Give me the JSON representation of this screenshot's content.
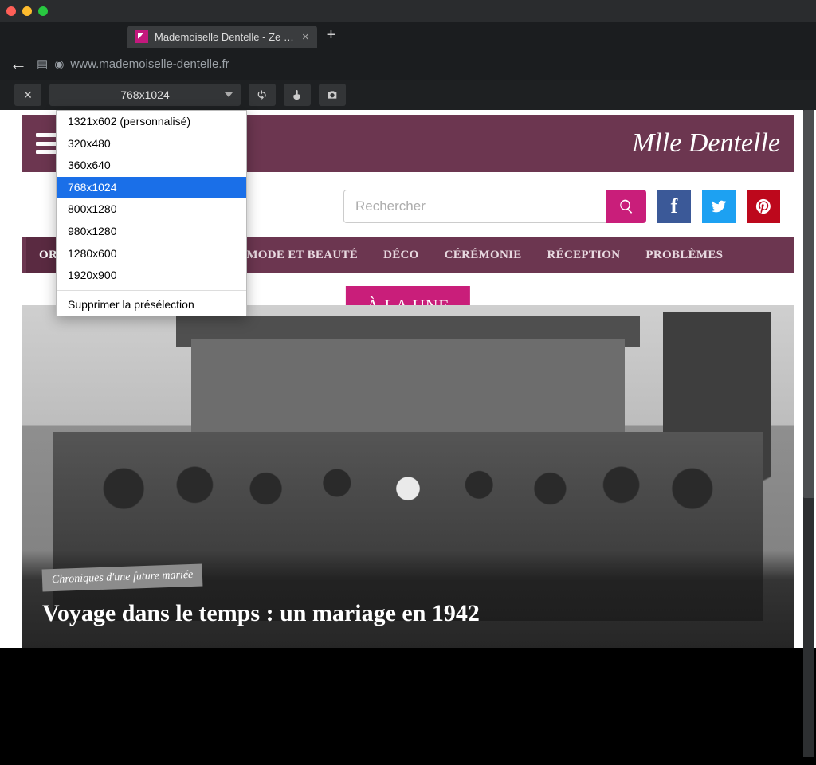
{
  "browser": {
    "tab_title": "Mademoiselle Dentelle - Ze …",
    "url": "www.mademoiselle-dentelle.fr"
  },
  "devtools": {
    "selected_preset": "768x1024",
    "presets": [
      "1321x602 (personnalisé)",
      "320x480",
      "360x640",
      "768x1024",
      "800x1280",
      "980x1280",
      "1280x600",
      "1920x900"
    ],
    "remove_label": "Supprimer la présélection"
  },
  "site": {
    "logo_text": "Mlle Dentelle",
    "search_placeholder": "Rechercher",
    "nav": [
      "ORGANISATION DU MARIAGE",
      "MODE ET BEAUTÉ",
      "DÉCO",
      "CÉRÉMONIE",
      "RÉCEPTION",
      "PROBLÈMES"
    ],
    "featured_badge": "À LA UNE",
    "featured_tag": "Chroniques d'une future mariée",
    "featured_title": "Voyage dans le temps : un mariage en 1942"
  }
}
